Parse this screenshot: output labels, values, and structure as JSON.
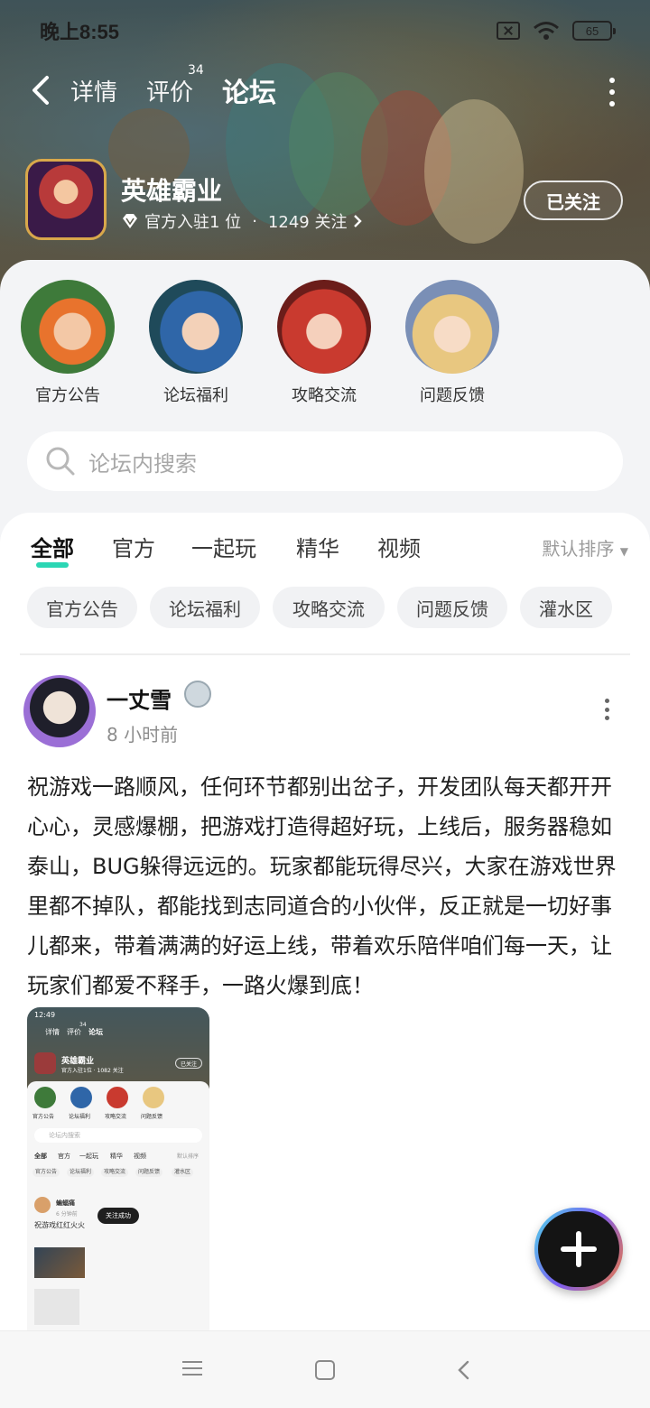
{
  "status_bar": {
    "time": "晚上8:55",
    "battery": "65"
  },
  "nav": {
    "tabs": [
      {
        "label": "详情"
      },
      {
        "label": "评价",
        "badge": "34"
      },
      {
        "label": "论坛"
      }
    ],
    "active_tab": "论坛"
  },
  "game": {
    "title": "英雄霸业",
    "official": "官方入驻1 位",
    "separator": "·",
    "followers": "1249 关注",
    "follow_button": "已关注"
  },
  "categories": [
    {
      "label": "官方公告",
      "color": "#3e7a3a"
    },
    {
      "label": "论坛福利",
      "color": "#2f66a8"
    },
    {
      "label": "攻略交流",
      "color": "#c93a2f"
    },
    {
      "label": "问题反馈",
      "color": "#e8c780"
    }
  ],
  "search": {
    "placeholder": "论坛内搜索"
  },
  "feed": {
    "tabs": [
      "全部",
      "官方",
      "一起玩",
      "精华",
      "视频"
    ],
    "active_tab": "全部",
    "sort": "默认排序",
    "chips": [
      "官方公告",
      "论坛福利",
      "攻略交流",
      "问题反馈",
      "灌水区"
    ]
  },
  "post": {
    "author": "一丈雪",
    "time": "8 小时前",
    "body": "祝游戏一路顺风，任何环节都别出岔子，开发团队每天都开开心心，灵感爆棚，把游戏打造得超好玩，上线后，服务器稳如泰山，BUG躲得远远的。玩家都能玩得尽兴，大家在游戏世界里都不掉队，都能找到志同道合的小伙伴，反正就是一切好事儿都来，带着满满的好运上线，带着欢乐陪伴咱们每一天，让玩家们都爱不释手，一路火爆到底！",
    "image": {
      "time": "12:49",
      "tabs": [
        "详情",
        "评价",
        "论坛"
      ],
      "badge": "34",
      "title": "英雄霸业",
      "meta": "官方入驻1位 · 1082 关注",
      "follow": "已关注",
      "categories": [
        "官方公告",
        "论坛福利",
        "攻略交流",
        "问题反馈"
      ],
      "search": "论坛内搜索",
      "feed_tabs": [
        "全部",
        "官方",
        "一起玩",
        "精华",
        "视频"
      ],
      "sort": "默认排序",
      "chips": [
        "官方公告",
        "论坛福利",
        "攻略交流",
        "问题反馈",
        "灌水区"
      ],
      "author": "蝙蝠痛",
      "post_time": "6 分钟前",
      "post_text": "祝游戏红红火火",
      "toast": "关注成功"
    }
  },
  "colors": {
    "accent": "#2bd6b4"
  }
}
